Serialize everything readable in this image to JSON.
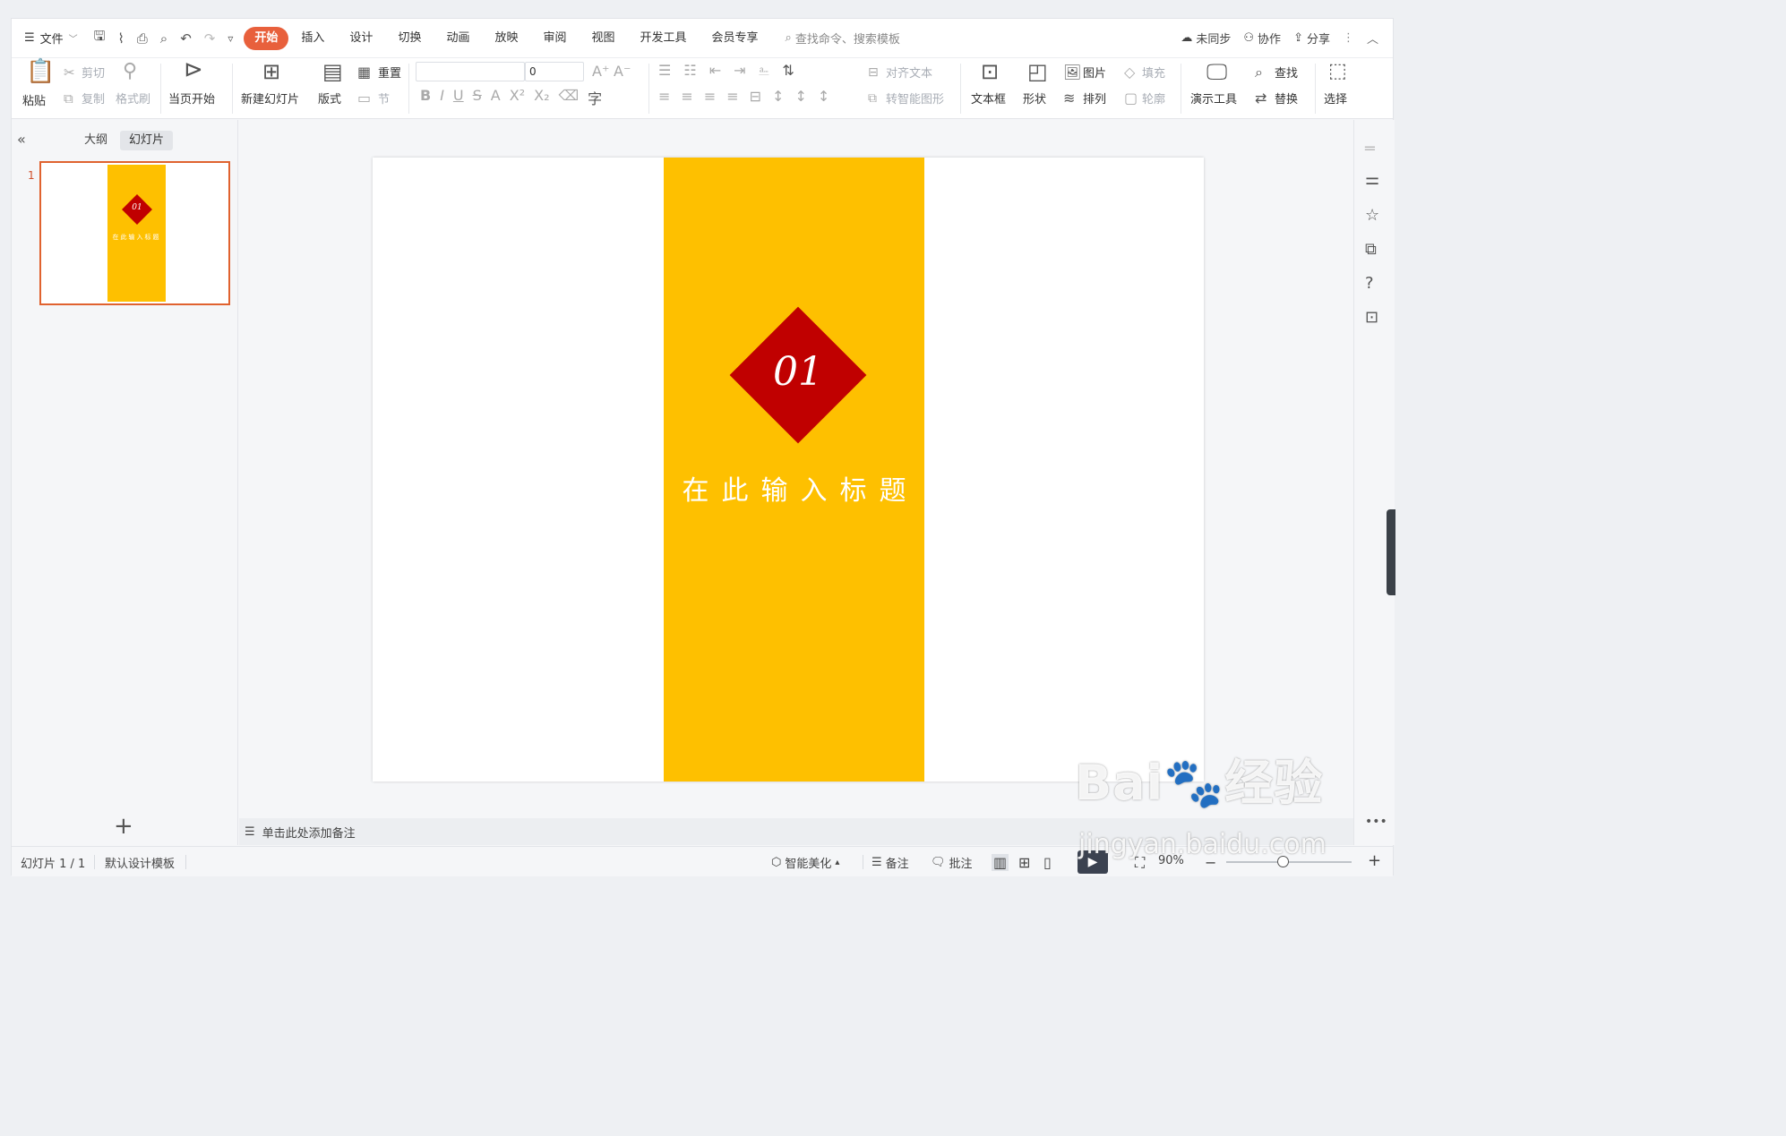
{
  "menubar": {
    "file_label": "文件",
    "tabs": [
      "开始",
      "插入",
      "设计",
      "切换",
      "动画",
      "放映",
      "审阅",
      "视图",
      "开发工具",
      "会员专享"
    ],
    "active_tab": "开始",
    "search_placeholder": "查找命令、搜索模板",
    "sync_label": "未同步",
    "collab_label": "协作",
    "share_label": "分享"
  },
  "ribbon": {
    "paste": "粘贴",
    "cut": "剪切",
    "copy": "复制",
    "format_painter": "格式刷",
    "play_from_current": "当页开始",
    "new_slide": "新建幻灯片",
    "layout": "版式",
    "reset": "重置",
    "section": "节",
    "font_name": "",
    "font_size": "0",
    "align_text": "对齐文本",
    "convert_smartart": "转智能图形",
    "textbox": "文本框",
    "shape": "形状",
    "picture": "图片",
    "fill": "填充",
    "arrange": "排列",
    "outline": "轮廓",
    "present_tools": "演示工具",
    "find": "查找",
    "replace": "替换",
    "select": "选择"
  },
  "left_panel": {
    "tab_outline": "大纲",
    "tab_slides": "幻灯片",
    "slide_number": "1"
  },
  "slide": {
    "number_text": "01",
    "title_text": "在此输入标题",
    "band_color": "#FEC000",
    "diamond_color": "#C00000"
  },
  "notes_placeholder": "单击此处添加备注",
  "status": {
    "slide_counter": "幻灯片 1 / 1",
    "template": "默认设计模板",
    "beautify": "智能美化",
    "notes": "备注",
    "comments": "批注",
    "zoom": "90%"
  },
  "watermark": {
    "brand": "Bai",
    "brand_cn": "经验",
    "url": "jingyan.baidu.com"
  }
}
